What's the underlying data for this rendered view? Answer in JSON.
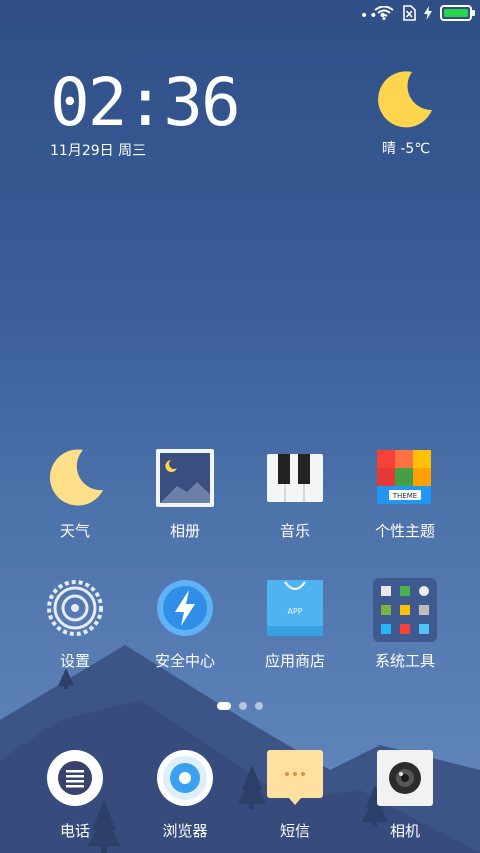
{
  "status_bar": {
    "more_dots": "•••",
    "icons": [
      "wifi-icon",
      "no-sim-icon",
      "charging-icon",
      "battery-icon"
    ],
    "battery_level": 1.0
  },
  "clock_widget": {
    "time": "02:36",
    "date": "11月29日 周三"
  },
  "weather_widget": {
    "icon": "moon-icon",
    "text": "晴 -5℃"
  },
  "apps_row1": [
    {
      "label": "天气",
      "icon": "weather-moon-icon"
    },
    {
      "label": "相册",
      "icon": "gallery-icon"
    },
    {
      "label": "音乐",
      "icon": "music-piano-icon"
    },
    {
      "label": "个性主题",
      "icon": "themes-icon"
    }
  ],
  "apps_row2": [
    {
      "label": "设置",
      "icon": "settings-gear-icon"
    },
    {
      "label": "安全中心",
      "icon": "security-bolt-icon"
    },
    {
      "label": "应用商店",
      "icon": "app-store-bag-icon"
    },
    {
      "label": "系统工具",
      "icon": "system-tools-folder-icon"
    }
  ],
  "theme_icon_text": "THEME",
  "app_store_icon_text": "APP",
  "page_indicator": {
    "count": 3,
    "active": 0
  },
  "dock": [
    {
      "label": "电话",
      "icon": "phone-icon"
    },
    {
      "label": "浏览器",
      "icon": "browser-icon"
    },
    {
      "label": "短信",
      "icon": "messages-icon"
    },
    {
      "label": "相机",
      "icon": "camera-icon"
    }
  ],
  "colors": {
    "battery_fill": "#2bd44e",
    "moon": "#ffd54f",
    "security": "#3aa0f0",
    "app_store": "#4fb3f0",
    "messages": "#ffe0a0"
  }
}
